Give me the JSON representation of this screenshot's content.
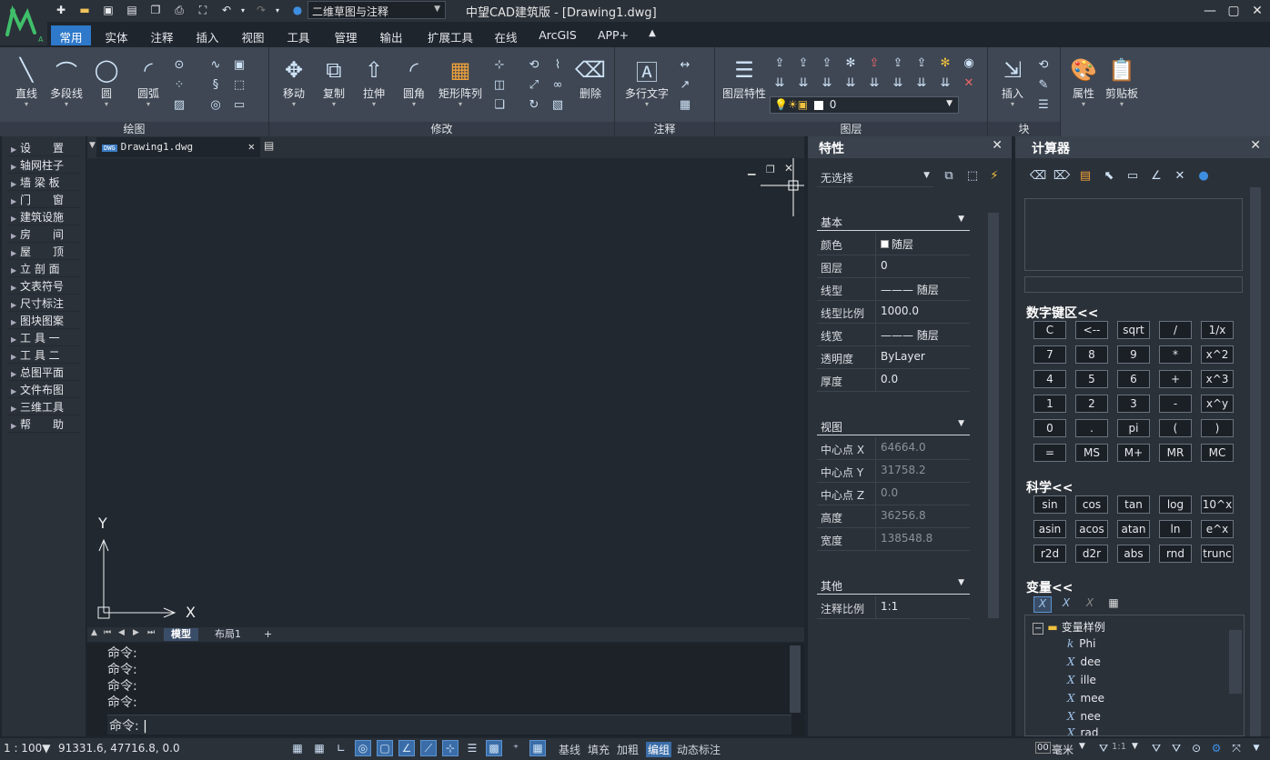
{
  "titlebar": {
    "workspace": "二维草图与注释",
    "app_title": "中望CAD建筑版 - [Drawing1.dwg]",
    "quick_access": [
      "new-icon",
      "open-icon",
      "save-icon",
      "save-as-icon",
      "print-preview-icon",
      "print-icon",
      "zoom-extents-icon",
      "undo-icon",
      "redo-icon",
      "help-icon"
    ]
  },
  "menu_tabs": [
    "常用",
    "实体",
    "注释",
    "插入",
    "视图",
    "工具",
    "管理",
    "输出",
    "扩展工具",
    "在线",
    "ArcGIS",
    "APP+"
  ],
  "ribbon": {
    "draw": {
      "label": "绘图",
      "buttons": [
        "直线",
        "多段线",
        "圆",
        "圆弧"
      ]
    },
    "modify": {
      "label": "修改",
      "buttons": [
        "移动",
        "复制",
        "拉伸",
        "圆角",
        "矩形阵列",
        "删除"
      ]
    },
    "annotate": {
      "label": "注释",
      "buttons": [
        "多行文字"
      ]
    },
    "layers": {
      "label": "图层",
      "buttons": [
        "图层特性"
      ],
      "current_layer": "0"
    },
    "block": {
      "label": "块",
      "buttons": [
        "插入"
      ]
    },
    "extra": {
      "buttons": [
        "属性",
        "剪贴板"
      ]
    }
  },
  "left_palette": [
    "设　　置",
    "轴网柱子",
    "墙 梁 板",
    "门　　窗",
    "建筑设施",
    "房　　间",
    "屋　　顶",
    "立 剖 面",
    "文表符号",
    "尺寸标注",
    "图块图案",
    "工 具 一",
    "工 具 二",
    "总图平面",
    "文件布图",
    "三维工具",
    "帮　　助"
  ],
  "document": {
    "tab": "Drawing1.dwg",
    "ucs": {
      "x": "X",
      "y": "Y"
    },
    "layout_tabs": [
      "模型",
      "布局1",
      "+"
    ]
  },
  "command": {
    "history": [
      "命令:",
      "命令:",
      "命令:",
      "命令:"
    ],
    "prompt": "命令:"
  },
  "properties": {
    "title": "特性",
    "selection": "无选择",
    "basic": {
      "label": "基本",
      "rows": [
        {
          "k": "颜色",
          "v": "随层"
        },
        {
          "k": "图层",
          "v": "0"
        },
        {
          "k": "线型",
          "v": "——— 随层"
        },
        {
          "k": "线型比例",
          "v": "1000.0"
        },
        {
          "k": "线宽",
          "v": "——— 随层"
        },
        {
          "k": "透明度",
          "v": "ByLayer"
        },
        {
          "k": "厚度",
          "v": "0.0"
        }
      ]
    },
    "view": {
      "label": "视图",
      "rows": [
        {
          "k": "中心点 X",
          "v": "64664.0"
        },
        {
          "k": "中心点 Y",
          "v": "31758.2"
        },
        {
          "k": "中心点 Z",
          "v": "0.0"
        },
        {
          "k": "高度",
          "v": "36256.8"
        },
        {
          "k": "宽度",
          "v": "138548.8"
        }
      ]
    },
    "other": {
      "label": "其他",
      "rows": [
        {
          "k": "注释比例",
          "v": "1:1"
        }
      ]
    }
  },
  "calculator": {
    "title": "计算器",
    "numpad_label": "数字键区<<",
    "numpad": [
      [
        "C",
        "<--",
        "sqrt",
        "/",
        "1/x"
      ],
      [
        "7",
        "8",
        "9",
        "*",
        "x^2"
      ],
      [
        "4",
        "5",
        "6",
        "+",
        "x^3"
      ],
      [
        "1",
        "2",
        "3",
        "-",
        "x^y"
      ],
      [
        "0",
        ".",
        "pi",
        "(",
        ")"
      ],
      [
        "=",
        "MS",
        "M+",
        "MR",
        "MC"
      ]
    ],
    "science_label": "科学<<",
    "science": [
      [
        "sin",
        "cos",
        "tan",
        "log",
        "10^x"
      ],
      [
        "asin",
        "acos",
        "atan",
        "ln",
        "e^x"
      ],
      [
        "r2d",
        "d2r",
        "abs",
        "rnd",
        "trunc"
      ]
    ],
    "variables_label": "变量<<",
    "variables_root": "变量样例",
    "variables": [
      {
        "type": "k",
        "name": "Phi"
      },
      {
        "type": "X",
        "name": "dee"
      },
      {
        "type": "X",
        "name": "ille"
      },
      {
        "type": "X",
        "name": "mee"
      },
      {
        "type": "X",
        "name": "nee"
      },
      {
        "type": "X",
        "name": "rad"
      }
    ]
  },
  "statusbar": {
    "scale": "1 : 100▼",
    "coords": "91331.6, 47716.8, 0.0",
    "toggles": [
      "基线",
      "填充",
      "加粗",
      "编组",
      "动态标注"
    ],
    "active_toggle": "编组",
    "units": "毫米",
    "anno_scale": "1:1"
  }
}
